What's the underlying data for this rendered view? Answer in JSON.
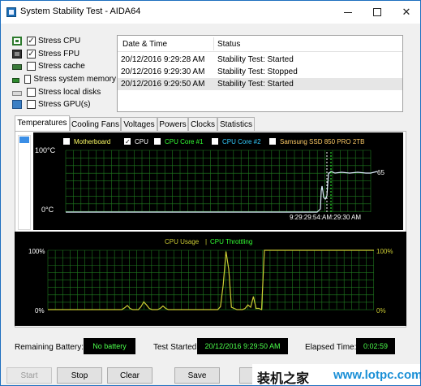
{
  "window": {
    "title": "System Stability Test - AIDA64"
  },
  "stress": [
    {
      "label": "Stress CPU",
      "checked": true,
      "icon": "cpu-icon"
    },
    {
      "label": "Stress FPU",
      "checked": true,
      "icon": "fpu-icon"
    },
    {
      "label": "Stress cache",
      "checked": false,
      "icon": "cache-icon"
    },
    {
      "label": "Stress system memory",
      "checked": false,
      "icon": "memory-icon"
    },
    {
      "label": "Stress local disks",
      "checked": false,
      "icon": "disk-icon"
    },
    {
      "label": "Stress GPU(s)",
      "checked": false,
      "icon": "gpu-icon"
    }
  ],
  "log": {
    "headers": {
      "date": "Date & Time",
      "status": "Status"
    },
    "rows": [
      {
        "date": "20/12/2016 9:29:28 AM",
        "status": "Stability Test: Started",
        "selected": false
      },
      {
        "date": "20/12/2016 9:29:30 AM",
        "status": "Stability Test: Stopped",
        "selected": false
      },
      {
        "date": "20/12/2016 9:29:50 AM",
        "status": "Stability Test: Started",
        "selected": true
      }
    ]
  },
  "tabs": [
    {
      "label": "Temperatures",
      "active": true
    },
    {
      "label": "Cooling Fans",
      "active": false
    },
    {
      "label": "Voltages",
      "active": false
    },
    {
      "label": "Powers",
      "active": false
    },
    {
      "label": "Clocks",
      "active": false
    },
    {
      "label": "Statistics",
      "active": false
    }
  ],
  "temp_graph": {
    "legend": [
      {
        "label": "Motherboard",
        "checked": false,
        "color": "#ffff66"
      },
      {
        "label": "CPU",
        "checked": true,
        "color": "#ffffff"
      },
      {
        "label": "CPU Core #1",
        "checked": false,
        "color": "#33ff33"
      },
      {
        "label": "CPU Core #2",
        "checked": false,
        "color": "#33ccff"
      },
      {
        "label": "Samsung SSD 850 PRO 2TB",
        "checked": false,
        "color": "#ffcc66"
      }
    ],
    "y_top_label": "100°C",
    "y_bottom_label": "0°C",
    "time_label": "9:29:29:54:AM:29:30 AM",
    "current_value": "65",
    "grid_color": "#1f7a1f",
    "line_color": "#dfefff"
  },
  "chart_data": {
    "type": "line",
    "title": "",
    "series": [
      {
        "name": "CPU Usage",
        "color": "#cccc33",
        "values": [
          0,
          0,
          0,
          0,
          0,
          0,
          0,
          0,
          0,
          0,
          0,
          0,
          0,
          0,
          0,
          0,
          0,
          0,
          0,
          0,
          0,
          0,
          0,
          0,
          0,
          0,
          0,
          0,
          3,
          7,
          2,
          0,
          0,
          0,
          5,
          13,
          8,
          2,
          0,
          0,
          0,
          2,
          6,
          2,
          0,
          0,
          0,
          0,
          0,
          0,
          0,
          0,
          0,
          0,
          0,
          0,
          0,
          0,
          0,
          0,
          0,
          0,
          0,
          5,
          42,
          98,
          68,
          4,
          2,
          0,
          0,
          0,
          2,
          8,
          4,
          22,
          2,
          2,
          0,
          100,
          100,
          100,
          100,
          100,
          100,
          100,
          100,
          100,
          100,
          100,
          100,
          100,
          100,
          100,
          100,
          100,
          100,
          100,
          100,
          100,
          100,
          100,
          100,
          100,
          100,
          100,
          100,
          100,
          100,
          100,
          100,
          100,
          100,
          100,
          100,
          100,
          100,
          100,
          100,
          100
        ]
      },
      {
        "name": "CPU Throttling",
        "color": "#33ff33",
        "values": []
      }
    ],
    "y_left_labels": [
      "100%",
      "0%"
    ],
    "y_right_labels": [
      "100%",
      "0%"
    ],
    "ylim": [
      0,
      100
    ],
    "grid": true
  },
  "status": {
    "battery_label": "Remaining Battery:",
    "battery_value": "No battery",
    "started_label": "Test Started:",
    "started_value": "20/12/2016 9:29:50 AM",
    "elapsed_label": "Elapsed Time:",
    "elapsed_value": "0:02:59"
  },
  "buttons": {
    "start": "Start",
    "stop": "Stop",
    "clear": "Clear",
    "save": "Save"
  },
  "watermark": {
    "text": "装机之家",
    "url": "www.lotpc.com"
  }
}
